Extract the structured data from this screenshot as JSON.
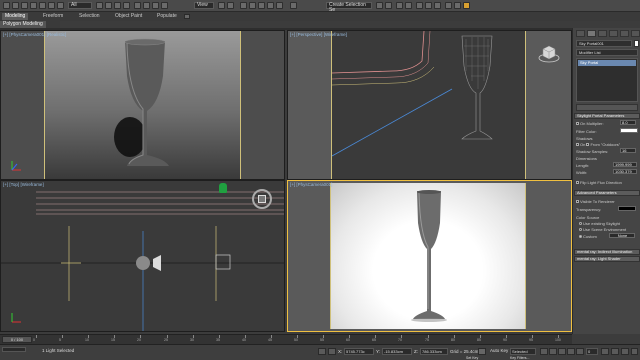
{
  "toolbar": {
    "workspace_dropdown": "All",
    "view_dropdown": "View",
    "selection_set": "Create Selection Se"
  },
  "ribbon": {
    "tabs": [
      {
        "label": "Modeling",
        "active": true
      },
      {
        "label": "Freeform",
        "active": false
      },
      {
        "label": "Selection",
        "active": false
      },
      {
        "label": "Object Paint",
        "active": false
      },
      {
        "label": "Populate",
        "active": false
      }
    ],
    "sub_label": "Polygon Modeling"
  },
  "viewports": {
    "top_left": {
      "bracket": "[+]",
      "view": "[PhysCamera001]",
      "shading": "[Realistic]"
    },
    "top_right": {
      "bracket": "[+]",
      "view": "[Perspective]",
      "shading": "[Wireframe]"
    },
    "bottom_left": {
      "bracket": "[+]",
      "view": "[Top]",
      "shading": "[Wireframe]"
    },
    "bottom_right": {
      "bracket": "[+]",
      "view": "[PhysCamera001]",
      "shading": ""
    }
  },
  "command_panel": {
    "object_name": "Sky Portal001",
    "modifier_list": "Modifier List",
    "stack_item": "Sky Portal",
    "rollout_params": "Skylight Portal Parameters",
    "on_label": "On",
    "multiplier_label": "Multiplier:",
    "multiplier_value": "8.0",
    "filter_color_label": "Filter Color:",
    "shadows_label": "Shadows",
    "shadows_on": "On",
    "from_outdoors": "From \"Outdoors\"",
    "shadow_samples_label": "Shadow Samples:",
    "shadow_samples_value": "16",
    "dimensions_label": "Dimensions",
    "length_label": "Length:",
    "length_value": "1999.999",
    "width_label": "Width:",
    "width_value": "1030.379",
    "flip_label": "Flip Light Flux Direction",
    "advanced_rollout": "Advanced Parameters",
    "visible_renderer": "Visible To Renderer",
    "transparency_label": "Transparency:",
    "color_source_label": "Color Source",
    "use_existing": "Use existing Skylight",
    "use_scene_env": "Use Scene Environment",
    "custom_label": "Custom",
    "none_label": "None",
    "rollout_indirect": "mental ray: Indirect Illumination",
    "rollout_shader": "mental ray: Light Shader"
  },
  "timeline": {
    "frame_display": "0 / 100",
    "ticks": [
      "0",
      "5",
      "10",
      "15",
      "20",
      "25",
      "30",
      "35",
      "40",
      "45",
      "50",
      "55",
      "60",
      "65",
      "70",
      "75",
      "80",
      "85",
      "90",
      "95",
      "100"
    ]
  },
  "status": {
    "selection": "1 Light Selected",
    "x_value": "5745.773c",
    "y_value": "-15.833cm",
    "z_value": "786.333cm",
    "grid": "Grid = 25.4cm",
    "auto_key": "Auto Key",
    "selected_dropdown": "Selected",
    "set_key": "Set Key",
    "key_filters": "Key Filters...",
    "frame_field": "0"
  },
  "colors": {
    "active_viewport_border": "#f0c040",
    "panel_bg": "#454545",
    "ui_bg": "#3c3c3c"
  }
}
